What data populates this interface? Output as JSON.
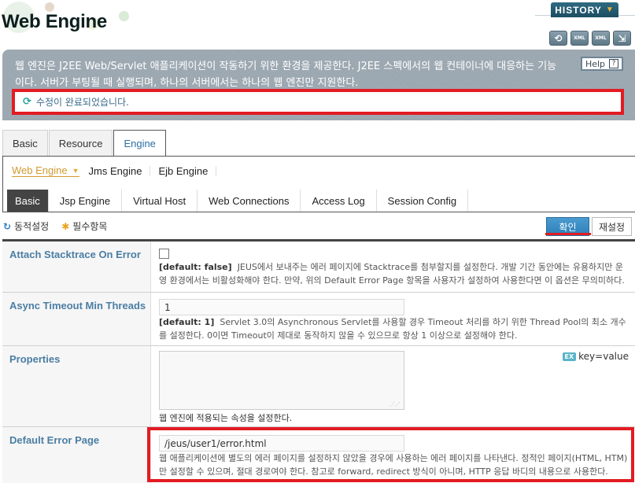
{
  "header": {
    "title": "Web Engine",
    "history_label": "HISTORY",
    "tool_icons": [
      {
        "name": "reload-icon",
        "glyph": "⟲"
      },
      {
        "name": "xml-export-icon",
        "glyph": "XML"
      },
      {
        "name": "xml-import-icon",
        "glyph": "XML"
      },
      {
        "name": "apply-icon",
        "glyph": "⇲"
      }
    ]
  },
  "info": {
    "description": "웹 엔진은 J2EE Web/Servlet 애플리케이션이 작동하기 위한 환경을 제공한다. J2EE 스펙에서의 웹 컨테이너에 대응하는 기능이다. 서버가 부팅될 때 실행되며, 하나의 서버에서는 하나의 웹 엔진만 지원한다.",
    "help_label": "Help",
    "help_glyph": "?",
    "message": "수정이 완료되었습니다."
  },
  "tabs": {
    "top": [
      {
        "label": "Basic",
        "active": false
      },
      {
        "label": "Resource",
        "active": false
      },
      {
        "label": "Engine",
        "active": true
      }
    ],
    "engine_nav": [
      {
        "label": "Web Engine",
        "active": true
      },
      {
        "label": "Jms Engine",
        "active": false
      },
      {
        "label": "Ejb Engine",
        "active": false
      }
    ],
    "sub": [
      {
        "label": "Basic",
        "active": true
      },
      {
        "label": "Jsp Engine",
        "active": false
      },
      {
        "label": "Virtual Host",
        "active": false
      },
      {
        "label": "Web Connections",
        "active": false
      },
      {
        "label": "Access Log",
        "active": false
      },
      {
        "label": "Session Config",
        "active": false
      }
    ]
  },
  "legend": {
    "dynamic": "동적설정",
    "required": "필수항목"
  },
  "buttons": {
    "ok": "확인",
    "reset": "재설정"
  },
  "fields": {
    "attach_stacktrace": {
      "label": "Attach Stacktrace On Error",
      "checked": false,
      "default": "[default: false]",
      "desc": "JEUS에서 보내주는 에러 페이지에 Stacktrace를 첨부할지를 설정한다. 개발 기간 동안에는 유용하지만 운영 환경에서는 비활성화해야 한다. 만약, 위의 Default Error Page 항목을 사용자가 설정하여 사용한다면 이 옵션은 무의미하다."
    },
    "async_timeout": {
      "label": "Async Timeout Min Threads",
      "value": "1",
      "default": "[default: 1]",
      "desc": "Servlet 3.0의 Asynchronous Servlet를 사용할 경우 Timeout 처리를 하기 위한 Thread Pool의 최소 개수를 설정한다. 0이면 Timeout이 제대로 동작하지 않을 수 있으므로 항상 1 이상으로 설정해야 한다."
    },
    "properties": {
      "label": "Properties",
      "value": "",
      "ex_badge": "EX",
      "ex_hint": "key=value",
      "desc": "웹 엔진에 적용되는 속성을 설정한다."
    },
    "default_error_page": {
      "label": "Default Error Page",
      "value": "/jeus/user1/error.html",
      "desc": "웹 애플리케이션에 별도의 에러 페이지를 설정하지 않았을 경우에 사용하는 에러 페이지를 나타낸다. 정적인 페이지(HTML, HTM)만 설정할 수 있으며, 절대 경로여야 한다. 참고로 forward, redirect 방식이 아니며, HTTP 응답 바디의 내용으로 사용한다."
    }
  },
  "colors": {
    "highlight_red": "#e31b23",
    "accent_blue": "#2e7fb8",
    "label_blue": "#4a7ea3",
    "active_orange": "#d39a2e"
  }
}
